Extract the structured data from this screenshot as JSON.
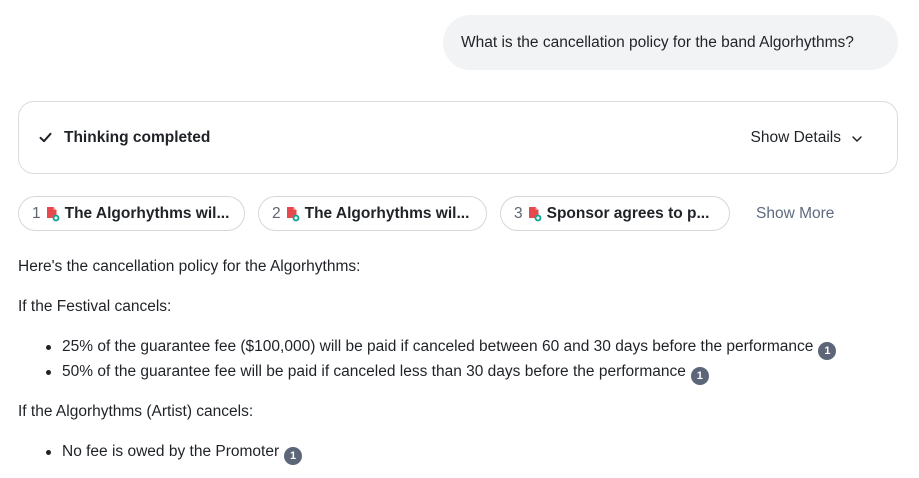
{
  "user_message": "What is the cancellation policy for the band Algorhythms?",
  "thinking": {
    "status_label": "Thinking completed",
    "details_label": "Show Details"
  },
  "citations": [
    {
      "num": "1",
      "title": "The Algorhythms wil..."
    },
    {
      "num": "2",
      "title": "The Algorhythms wil..."
    },
    {
      "num": "3",
      "title": "Sponsor agrees to p..."
    }
  ],
  "show_more_label": "Show More",
  "answer": {
    "intro": "Here's the cancellation policy for the Algorhythms:",
    "festival_heading": "If the Festival cancels:",
    "festival_items": [
      {
        "text": "25% of the guarantee fee ($100,000) will be paid if canceled between 60 and 30 days before the performance",
        "cite": "1"
      },
      {
        "text": "50% of the guarantee fee will be paid if canceled less than 30 days before the performance",
        "cite": "1"
      }
    ],
    "artist_heading": "If the Algorhythms (Artist) cancels:",
    "artist_items": [
      {
        "text": "No fee is owed by the Promoter",
        "cite": "1"
      }
    ]
  },
  "colors": {
    "bubble_bg": "#f2f3f5",
    "badge_bg": "#5d6678",
    "pdf_red": "#e5484d",
    "pdf_teal": "#12a594",
    "link_gray": "#5e6b7e"
  },
  "icons": [
    "check-icon",
    "chevron-down-icon",
    "pdf-file-icon"
  ]
}
